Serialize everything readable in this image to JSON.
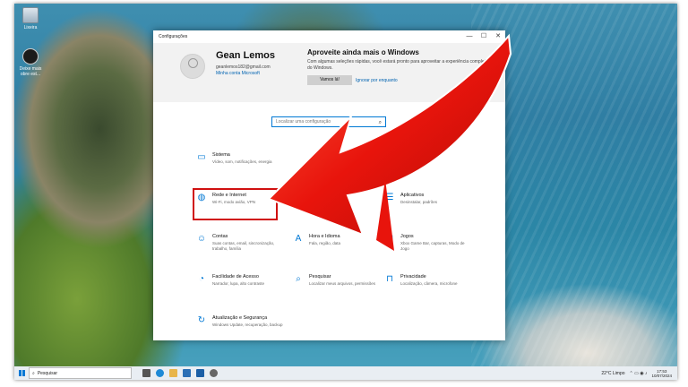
{
  "desktop": {
    "icons": [
      {
        "label": "Lixeira",
        "icon": "recycle-bin-icon"
      },
      {
        "label": "Deixe mais obre est...",
        "icon": "shortcut-icon"
      }
    ]
  },
  "window": {
    "title": "Configurações",
    "controls": [
      "—",
      "☐",
      "✕"
    ]
  },
  "profile": {
    "name": "Gean Lemos",
    "email": "geanlemos182@gmail.com",
    "link": "Minha conta Microsoft"
  },
  "promo": {
    "title": "Aproveite ainda mais o Windows",
    "text": "Com algumas seleções rápidas, você estará pronto para aproveitar a experiência completa do Windows.",
    "button": "Vamos lá!",
    "link": "Ignorar por enquanto"
  },
  "search": {
    "placeholder": "Localizar uma configuração"
  },
  "tiles": [
    {
      "title": "Sistema",
      "desc": "Vídeo, som, notificações, energia",
      "icon": "laptop-icon"
    },
    {
      "title": "Rede e Internet",
      "desc": "Wi-Fi, modo avião, VPN",
      "icon": "globe-icon"
    },
    {
      "title": "Aplicativos",
      "desc": "Desinstalar, padrões",
      "icon": "apps-icon"
    },
    {
      "title": "Contas",
      "desc": "Suas contas, email, sincronização, trabalho, família",
      "icon": "person-icon"
    },
    {
      "title": "Hora e Idioma",
      "desc": "Fala, região, data",
      "icon": "language-icon"
    },
    {
      "title": "Jogos",
      "desc": "Xbox Game Bar, capturas, Modo de Jogo",
      "icon": "gamepad-icon"
    },
    {
      "title": "Facilidade de Acesso",
      "desc": "Narrador, lupa, alto contraste",
      "icon": "accessibility-icon"
    },
    {
      "title": "Pesquisar",
      "desc": "Localizar meus arquivos, permissões",
      "icon": "search-icon"
    },
    {
      "title": "Privacidade",
      "desc": "Localização, câmera, microfone",
      "icon": "lock-icon"
    },
    {
      "title": "Atualização e Segurança",
      "desc": "Windows Update, recuperação, backup",
      "icon": "sync-icon"
    }
  ],
  "taskbar": {
    "search_label": "Pesquisar",
    "weather": "22°C  Limpo",
    "time": "17:53",
    "date": "10/07/2024"
  },
  "colors": {
    "accent": "#0078d4",
    "arrow": "#e8140c",
    "highlight": "#d01010"
  }
}
